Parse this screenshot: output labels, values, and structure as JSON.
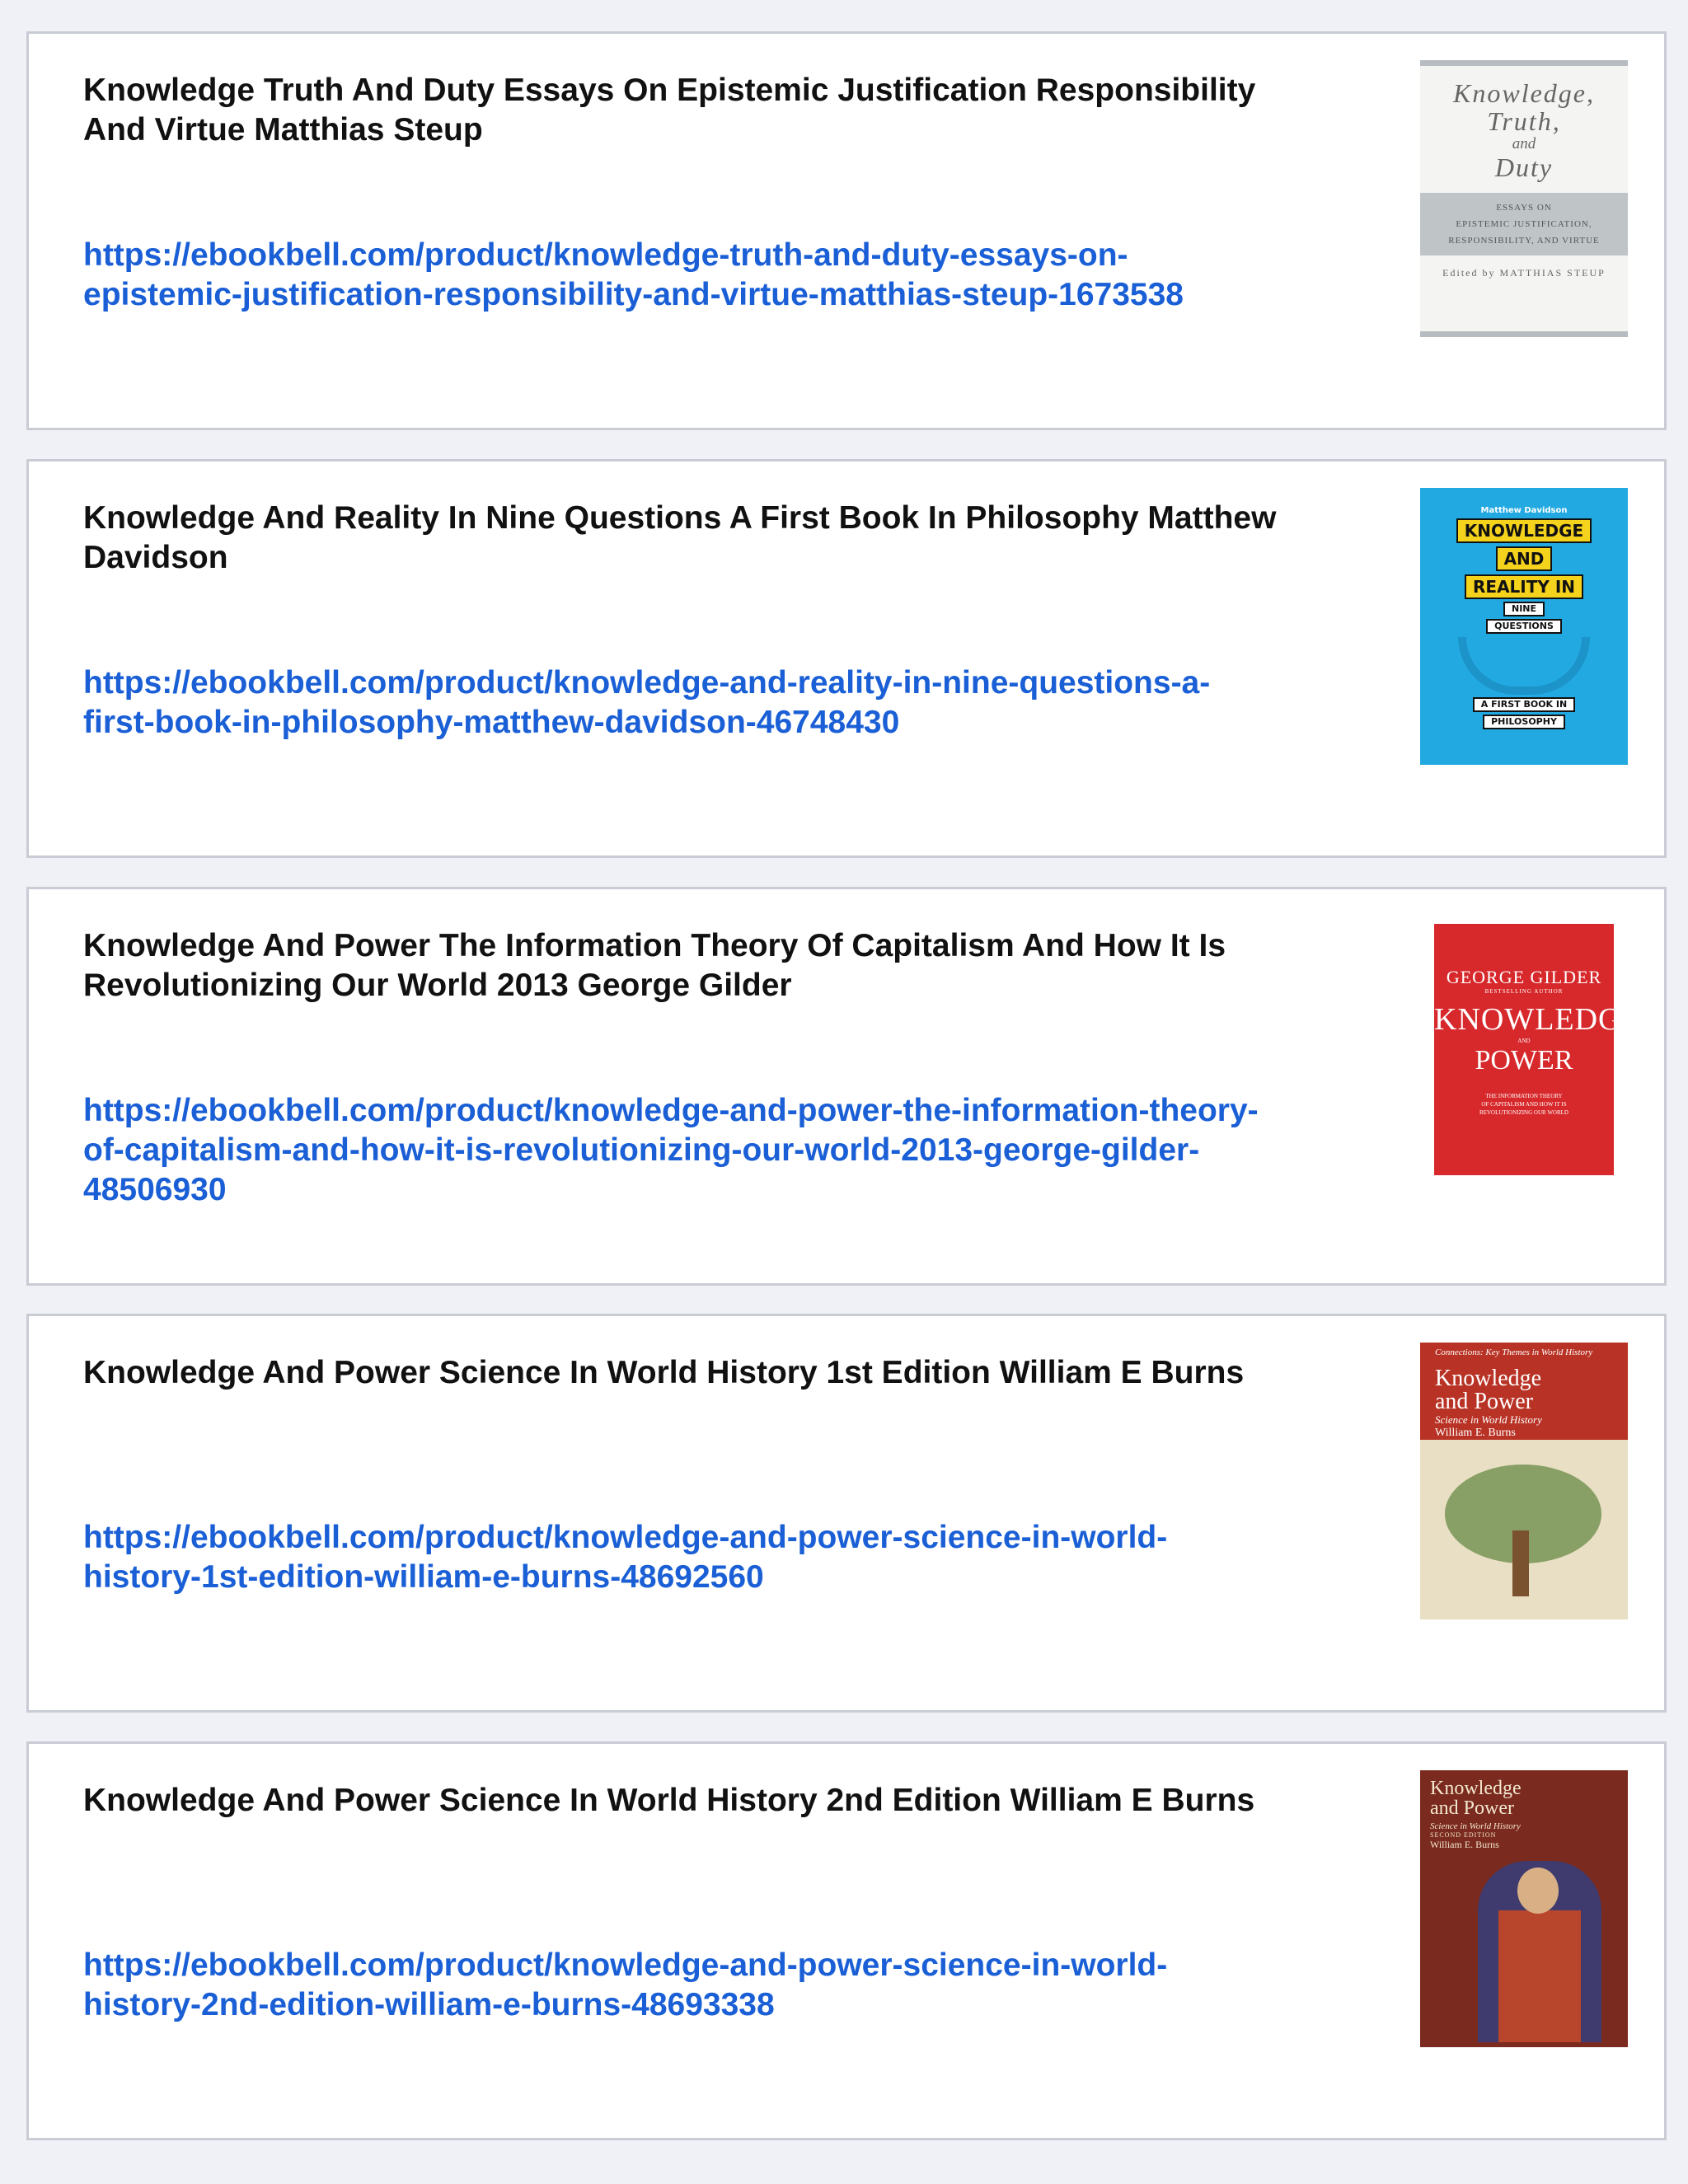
{
  "items": [
    {
      "title": "Knowledge Truth And Duty Essays On Epistemic Justification Responsibility And Virtue Matthias Steup",
      "url": "https://ebookbell.com/product/knowledge-truth-and-duty-essays-on-epistemic-justification-responsibility-and-virtue-matthias-steup-1673538",
      "cover": {
        "line1": "Knowledge,",
        "line2": "Truth,",
        "line3": "and",
        "line4": "Duty",
        "band1": "ESSAYS ON",
        "band2": "EPISTEMIC JUSTIFICATION,",
        "band3": "RESPONSIBILITY, AND VIRTUE",
        "editor": "Edited by MATTHIAS STEUP"
      }
    },
    {
      "title": "Knowledge And Reality In Nine Questions A First Book In Philosophy Matthew Davidson",
      "url": "https://ebookbell.com/product/knowledge-and-reality-in-nine-questions-a-first-book-in-philosophy-matthew-davidson-46748430",
      "cover": {
        "author": "Matthew Davidson",
        "w1": "KNOWLEDGE",
        "w2": "AND",
        "w3": "REALITY IN",
        "w4": "NINE",
        "w5": "QUESTIONS",
        "w6": "A FIRST BOOK IN",
        "w7": "PHILOSOPHY"
      }
    },
    {
      "title": "Knowledge And Power The Information Theory Of Capitalism And How It Is Revolutionizing Our World 2013 George Gilder",
      "url": "https://ebookbell.com/product/knowledge-and-power-the-information-theory-of-capitalism-and-how-it-is-revolutionizing-our-world-2013-george-gilder-48506930",
      "cover": {
        "author": "GEORGE GILDER",
        "sub": "BESTSELLING AUTHOR",
        "k": "KNOWLEDGE",
        "and": "AND",
        "p": "POWER",
        "it1": "THE INFORMATION THEORY",
        "it2": "OF CAPITALISM AND HOW IT IS",
        "it3": "REVOLUTIONIZING OUR WORLD"
      }
    },
    {
      "title": "Knowledge And Power Science In World History 1st Edition William E Burns",
      "url": "https://ebookbell.com/product/knowledge-and-power-science-in-world-history-1st-edition-william-e-burns-48692560",
      "cover": {
        "series": "Connections: Key Themes in World History",
        "k1": "Knowledge",
        "k2": "and Power",
        "sub": "Science in World History",
        "author": "William E. Burns"
      }
    },
    {
      "title": "Knowledge And Power Science In World History 2nd Edition William E Burns",
      "url": "https://ebookbell.com/product/knowledge-and-power-science-in-world-history-2nd-edition-william-e-burns-48693338",
      "cover": {
        "k1": "Knowledge",
        "k2": "and Power",
        "sub": "Science in World History",
        "edition": "SECOND EDITION",
        "author": "William E. Burns"
      }
    }
  ]
}
